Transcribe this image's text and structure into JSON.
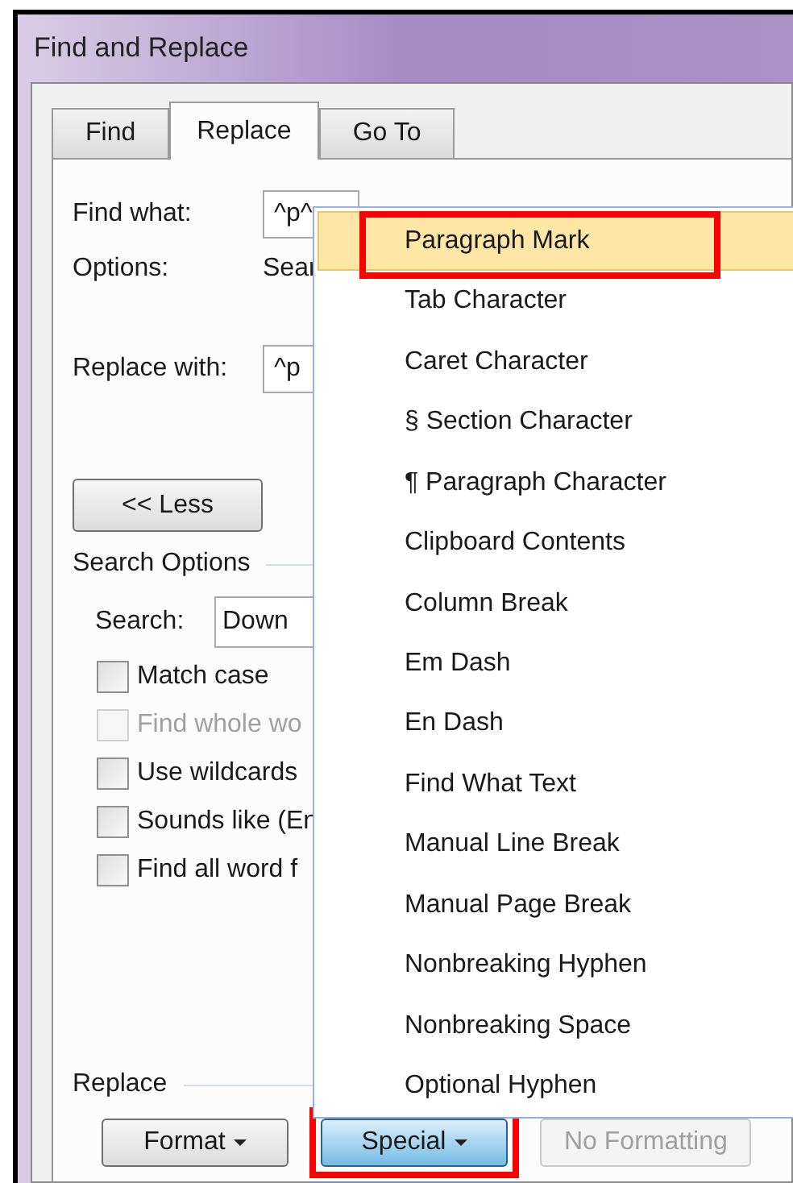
{
  "window": {
    "title": "Find and Replace"
  },
  "tabs": [
    {
      "label": "Find",
      "selected": false
    },
    {
      "label": "Replace",
      "selected": true
    },
    {
      "label": "Go To",
      "selected": false
    }
  ],
  "find_what": {
    "label": "Find what:",
    "value": "^p^"
  },
  "options": {
    "label": "Options:",
    "value": "Sear"
  },
  "replace_with": {
    "label": "Replace with:",
    "value": "^p"
  },
  "less_button": {
    "label": "<< Less"
  },
  "search_options": {
    "heading": "Search Options",
    "search_label": "Search:",
    "search_value": "Down",
    "checkboxes": [
      {
        "label": "Match case",
        "checked": false,
        "disabled": false
      },
      {
        "label": "Find whole wo",
        "checked": false,
        "disabled": true
      },
      {
        "label": "Use wildcards",
        "checked": false,
        "disabled": false
      },
      {
        "label": "Sounds like (En",
        "checked": false,
        "disabled": false
      },
      {
        "label": "Find all word f",
        "checked": false,
        "disabled": false
      }
    ]
  },
  "replace_section": {
    "heading": "Replace"
  },
  "buttons": [
    {
      "label": "Format",
      "kind": "dropdown",
      "pressed": false,
      "disabled": false,
      "callout": false
    },
    {
      "label": "Special",
      "kind": "dropdown",
      "pressed": true,
      "disabled": false,
      "callout": true
    },
    {
      "label": "No Formatting",
      "kind": "plain",
      "pressed": false,
      "disabled": true,
      "callout": false
    }
  ],
  "special_menu": {
    "items": [
      {
        "label": "Paragraph Mark",
        "selected": true,
        "callout": true
      },
      {
        "label": "Tab Character",
        "selected": false,
        "callout": false
      },
      {
        "label": "Caret Character",
        "selected": false,
        "callout": false
      },
      {
        "label": "§ Section Character",
        "selected": false,
        "callout": false
      },
      {
        "label": "¶ Paragraph Character",
        "selected": false,
        "callout": false
      },
      {
        "label": "Clipboard Contents",
        "selected": false,
        "callout": false
      },
      {
        "label": "Column Break",
        "selected": false,
        "callout": false
      },
      {
        "label": "Em Dash",
        "selected": false,
        "callout": false
      },
      {
        "label": "En Dash",
        "selected": false,
        "callout": false
      },
      {
        "label": "Find What Text",
        "selected": false,
        "callout": false
      },
      {
        "label": "Manual Line Break",
        "selected": false,
        "callout": false
      },
      {
        "label": "Manual Page Break",
        "selected": false,
        "callout": false
      },
      {
        "label": "Nonbreaking Hyphen",
        "selected": false,
        "callout": false
      },
      {
        "label": "Nonbreaking Space",
        "selected": false,
        "callout": false
      },
      {
        "label": "Optional Hyphen",
        "selected": false,
        "callout": false
      }
    ]
  }
}
